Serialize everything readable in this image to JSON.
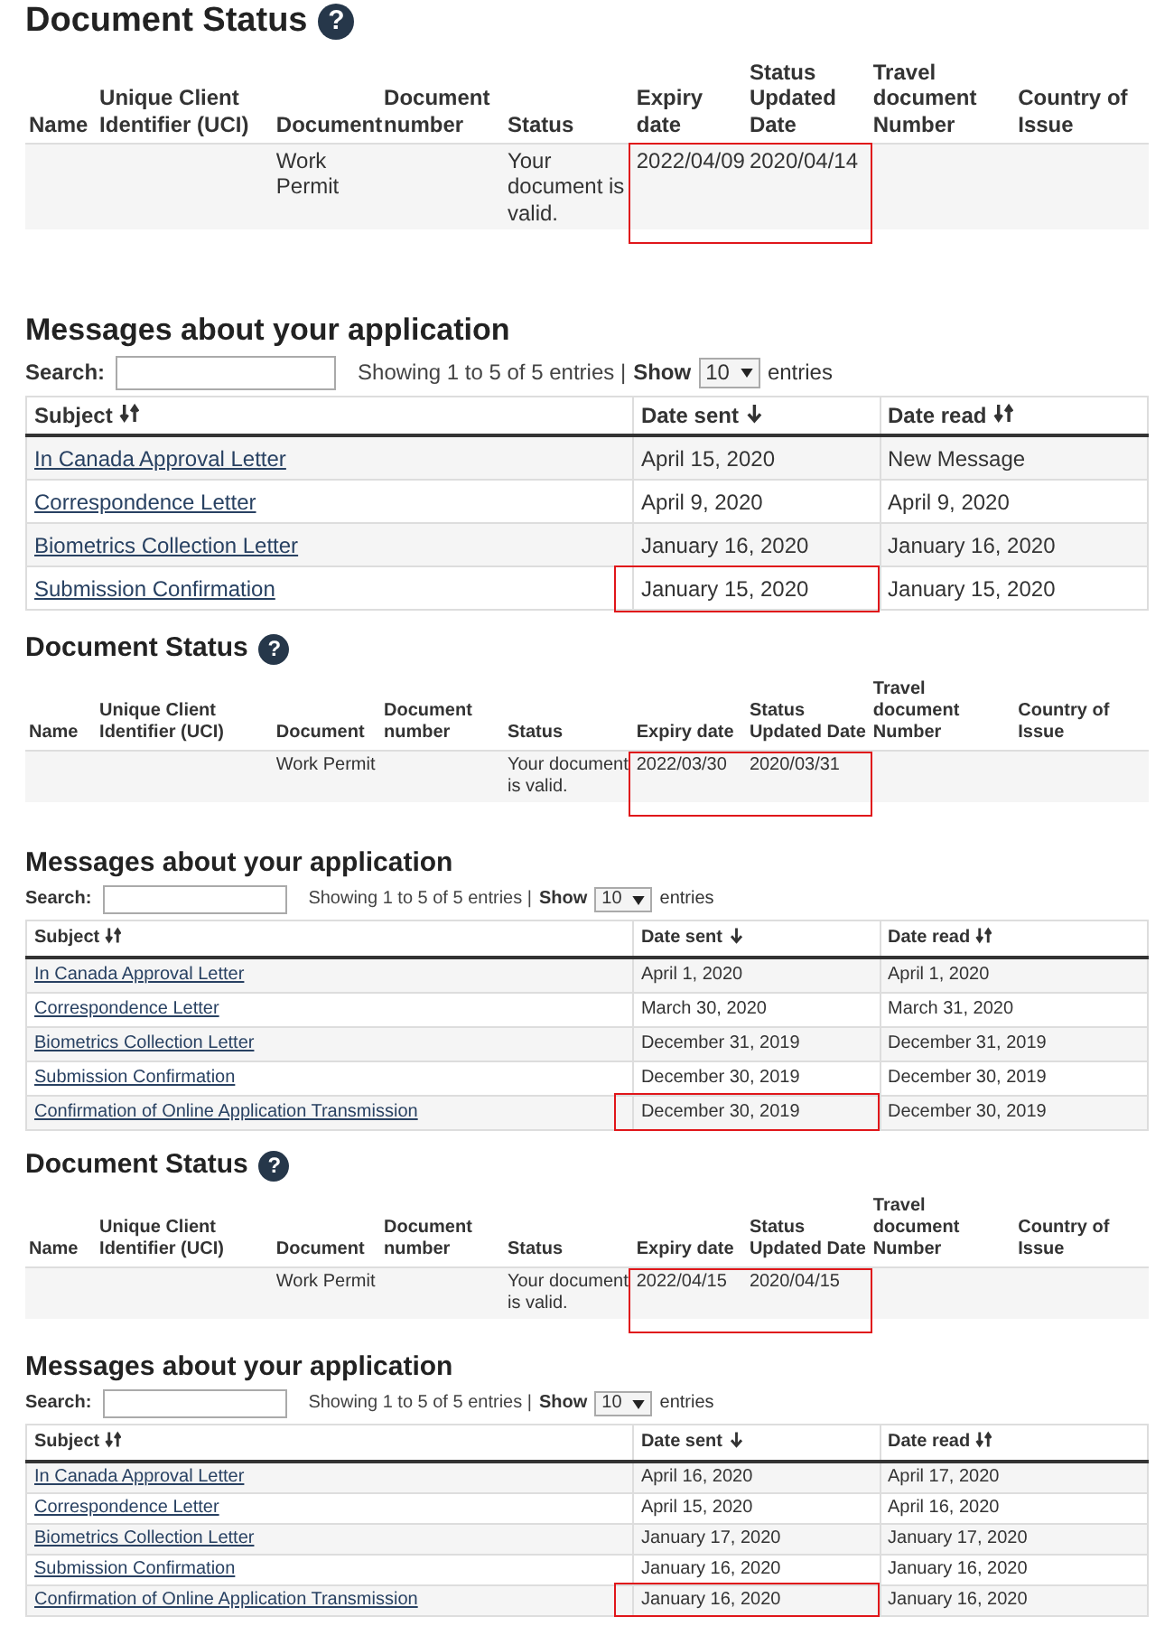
{
  "panels": [
    {
      "document_status": {
        "title": "Document Status",
        "help_icon": "?",
        "columns": [
          "Name",
          "Unique Client Identifier (UCI)",
          "Document",
          "Document number",
          "Status",
          "Expiry date",
          "Status Updated Date",
          "Travel document Number",
          "Country of Issue"
        ],
        "rows": [
          {
            "document": "Work Permit",
            "status": "Your document is valid.",
            "expiry_date": "2022/04/09",
            "status_updated_date": "2020/04/14",
            "highlighted": true
          }
        ]
      },
      "messages": {
        "title": "Messages about your application",
        "search_label": "Search:",
        "info": "Showing 1 to 5 of 5 entries |",
        "show_label": "Show",
        "page_size": "10",
        "entries_label": "entries",
        "columns": [
          {
            "label": "Subject",
            "kind": "sortable"
          },
          {
            "label": "Date sent",
            "kind": "sorted"
          },
          {
            "label": "Date read",
            "kind": "sortable"
          }
        ],
        "rows": [
          {
            "subject": "In Canada Approval Letter",
            "date_sent": "April 15, 2020",
            "date_read": "New Message",
            "date_sent_highlighted": false
          },
          {
            "subject": "Correspondence Letter",
            "date_sent": "April 9, 2020",
            "date_read": "April 9, 2020",
            "date_sent_highlighted": false
          },
          {
            "subject": "Biometrics Collection Letter",
            "date_sent": "January 16, 2020",
            "date_read": "January 16, 2020",
            "date_sent_highlighted": false
          },
          {
            "subject": "Submission Confirmation",
            "date_sent": "January 15, 2020",
            "date_read": "January 15, 2020",
            "date_sent_highlighted": true
          }
        ]
      }
    },
    {
      "document_status": {
        "title": "Document Status",
        "help_icon": "?",
        "columns": [
          "Name",
          "Unique Client Identifier (UCI)",
          "Document",
          "Document number",
          "Status",
          "Expiry date",
          "Status Updated Date",
          "Travel document Number",
          "Country of Issue"
        ],
        "rows": [
          {
            "document": "Work Permit",
            "status": "Your document is valid.",
            "expiry_date": "2022/03/30",
            "status_updated_date": "2020/03/31",
            "highlighted": true
          }
        ]
      },
      "messages": {
        "title": "Messages about your application",
        "search_label": "Search:",
        "info": "Showing 1 to 5 of 5 entries |",
        "show_label": "Show",
        "page_size": "10",
        "entries_label": "entries",
        "columns": [
          {
            "label": "Subject",
            "kind": "sortable"
          },
          {
            "label": "Date sent",
            "kind": "sorted"
          },
          {
            "label": "Date read",
            "kind": "sortable"
          }
        ],
        "rows": [
          {
            "subject": "In Canada Approval Letter",
            "date_sent": "April 1, 2020",
            "date_read": "April 1, 2020",
            "date_sent_highlighted": false
          },
          {
            "subject": "Correspondence Letter",
            "date_sent": "March 30, 2020",
            "date_read": "March 31, 2020",
            "date_sent_highlighted": false
          },
          {
            "subject": "Biometrics Collection Letter",
            "date_sent": "December 31, 2019",
            "date_read": "December 31, 2019",
            "date_sent_highlighted": false
          },
          {
            "subject": "Submission Confirmation",
            "date_sent": "December 30, 2019",
            "date_read": "December 30, 2019",
            "date_sent_highlighted": false
          },
          {
            "subject": "Confirmation of Online Application Transmission",
            "date_sent": "December 30, 2019",
            "date_read": "December 30, 2019",
            "date_sent_highlighted": true
          }
        ]
      }
    },
    {
      "document_status": {
        "title": "Document Status",
        "help_icon": "?",
        "columns": [
          "Name",
          "Unique Client Identifier (UCI)",
          "Document",
          "Document number",
          "Status",
          "Expiry date",
          "Status Updated Date",
          "Travel document Number",
          "Country of Issue"
        ],
        "rows": [
          {
            "document": "Work Permit",
            "status": "Your document is valid.",
            "expiry_date": "2022/04/15",
            "status_updated_date": "2020/04/15",
            "highlighted": true
          }
        ]
      },
      "messages": {
        "title": "Messages about your application",
        "search_label": "Search:",
        "info": "Showing 1 to 5 of 5 entries |",
        "show_label": "Show",
        "page_size": "10",
        "entries_label": "entries",
        "columns": [
          {
            "label": "Subject",
            "kind": "sortable"
          },
          {
            "label": "Date sent",
            "kind": "sorted"
          },
          {
            "label": "Date read",
            "kind": "sortable"
          }
        ],
        "rows": [
          {
            "subject": "In Canada Approval Letter",
            "date_sent": "April 16, 2020",
            "date_read": "April 17, 2020",
            "date_sent_highlighted": false
          },
          {
            "subject": "Correspondence Letter",
            "date_sent": "April 15, 2020",
            "date_read": "April 16, 2020",
            "date_sent_highlighted": false
          },
          {
            "subject": "Biometrics Collection Letter",
            "date_sent": "January 17, 2020",
            "date_read": "January 17, 2020",
            "date_sent_highlighted": false
          },
          {
            "subject": "Submission Confirmation",
            "date_sent": "January 16, 2020",
            "date_read": "January 16, 2020",
            "date_sent_highlighted": false
          },
          {
            "subject": "Confirmation of Online Application Transmission",
            "date_sent": "January 16, 2020",
            "date_read": "January 16, 2020",
            "date_sent_highlighted": true
          }
        ]
      }
    }
  ]
}
